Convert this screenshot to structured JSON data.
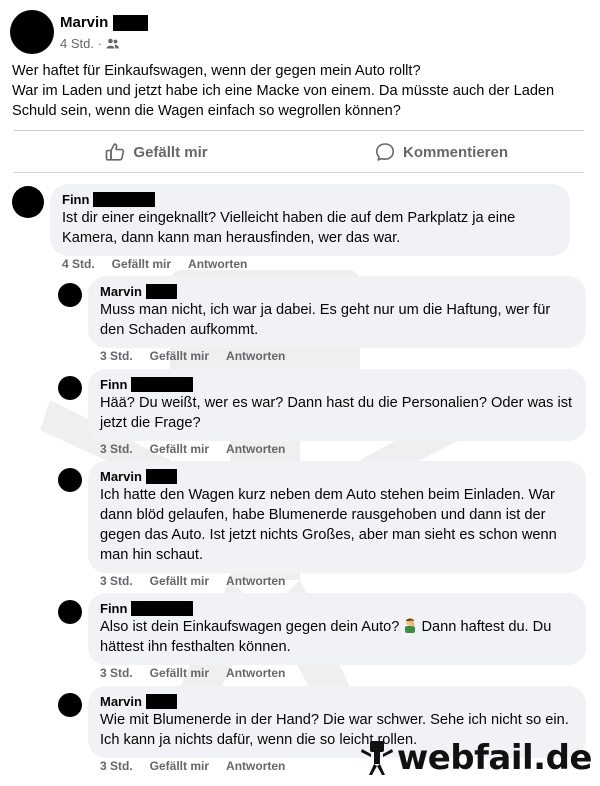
{
  "post": {
    "author": "Marvin",
    "time": "4 Std. ·",
    "audience_icon": "friends-icon",
    "body": "Wer haftet für Einkaufswagen, wenn der gegen mein Auto rollt?\nWar im Laden und jetzt habe ich eine Macke von einem. Da müsste auch der Laden Schuld sein, wenn die Wagen einfach so wegrollen können?"
  },
  "actions": {
    "like_label": "Gefällt mir",
    "comment_label": "Kommentieren"
  },
  "comments": [
    {
      "author": "Finn",
      "text": "Ist dir einer eingeknallt? Vielleicht haben die auf dem Parkplatz ja eine Kamera, dann kann man herausfinden, wer das war.",
      "time": "4 Std.",
      "like": "Gefällt mir",
      "reply": "Antworten"
    },
    {
      "author": "Marvin",
      "text": "Muss man nicht, ich war ja dabei. Es geht nur um die Haftung, wer für den Schaden aufkommt.",
      "time": "3 Std.",
      "like": "Gefällt mir",
      "reply": "Antworten"
    },
    {
      "author": "Finn",
      "text": "Hää? Du weißt, wer es war? Dann hast du die Personalien? Oder was ist jetzt die Frage?",
      "time": "3 Std.",
      "like": "Gefällt mir",
      "reply": "Antworten"
    },
    {
      "author": "Marvin",
      "text": "Ich hatte den Wagen kurz neben dem Auto stehen beim Einladen. War dann blöd gelaufen, habe Blumenerde rausgehoben und dann ist der gegen das Auto. Ist jetzt nichts Großes, aber man sieht es schon wenn man hin schaut.",
      "time": "3 Std.",
      "like": "Gefällt mir",
      "reply": "Antworten"
    },
    {
      "author": "Finn",
      "text_before": "Also ist dein Einkaufswagen gegen dein Auto?",
      "emoji": "facepalm-emoji",
      "text_after": "Dann haftest du. Du hättest ihn festhalten können.",
      "time": "3 Std.",
      "like": "Gefällt mir",
      "reply": "Antworten"
    },
    {
      "author": "Marvin",
      "text": "Wie mit Blumenerde in der Hand? Die war schwer. Sehe ich nicht so ein. Ich kann ja nichts dafür, wenn die so leicht rollen.",
      "time": "3 Std.",
      "like": "Gefällt mir",
      "reply": "Antworten"
    }
  ],
  "watermark": {
    "text": "webfail.de",
    "icon": "webfail-mascot-icon"
  }
}
